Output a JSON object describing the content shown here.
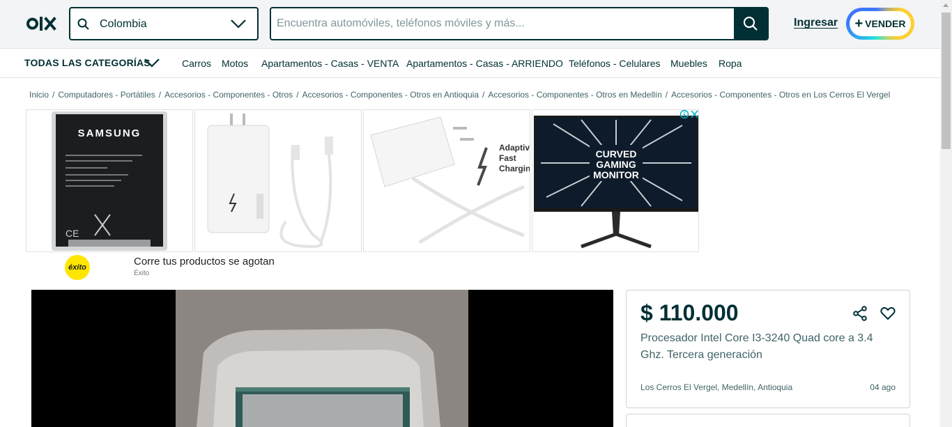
{
  "header": {
    "logo_text": "OLX",
    "location_value": "Colombia",
    "search_placeholder": "Encuentra automóviles, teléfonos móviles y más...",
    "login_label": "Ingresar",
    "sell_label": "VENDER"
  },
  "categories": {
    "all_label": "TODAS LAS CATEGORÍAS",
    "items": [
      "Carros",
      "Motos",
      "Apartamentos - Casas - VENTA",
      "Apartamentos - Casas - ARRIENDO",
      "Teléfonos - Celulares",
      "Muebles",
      "Ropa"
    ]
  },
  "breadcrumb": [
    "Inicio",
    "Computadores - Portátiles",
    "Accesorios - Componentes - Otros",
    "Accesorios - Componentes - Otros en Antioquia",
    "Accesorios - Componentes - Otros en Medellín",
    "Accesorios - Componentes - Otros en Los Cerros El Vergel"
  ],
  "sponsored": {
    "title": "Corre tus productos se agotan",
    "advertiser": "Éxito",
    "brand_logo_text": "éxito",
    "images": [
      {
        "name": "samsung-battery",
        "text": "SAMSUNG"
      },
      {
        "name": "charger-cable",
        "text": ""
      },
      {
        "name": "adaptive-charger",
        "text": "Adaptive Fast Charging"
      },
      {
        "name": "gaming-monitor",
        "text": "CURVED GAMING MONITOR"
      }
    ],
    "adchoices_icons": [
      "info-icon",
      "close-icon"
    ]
  },
  "listing": {
    "price": "$ 110.000",
    "title": "Procesador Intel Core I3-3240 Quad core a 3.4 Ghz. Tercera generación",
    "location": "Los Cerros El Vergel, Medellín, Antioquia",
    "date": "04 ago"
  },
  "colors": {
    "brand_dark": "#002f34",
    "header_bg": "#f2f4f5",
    "text_muted": "#406367",
    "sell_ring": [
      "#23e5db",
      "#3a77ff",
      "#ffce32"
    ],
    "exito_yellow": "#ffe600"
  }
}
